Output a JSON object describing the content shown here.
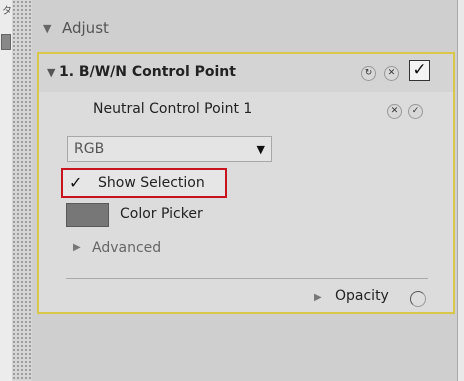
{
  "left_tool": {
    "glyph": "タ"
  },
  "adjust": {
    "label": "Adjust"
  },
  "control_point": {
    "title": "1. B/W/N Control Point",
    "reset_glyph": "↻",
    "delete_glyph": "✕",
    "enabled_glyph": "✓"
  },
  "neutral_point": {
    "label": "Neutral Control Point 1",
    "delete_glyph": "✕",
    "enabled_glyph": "✓"
  },
  "rgb_select": {
    "value": "RGB",
    "arrow": "▼"
  },
  "show_selection": {
    "label": "Show Selection",
    "check": "✓"
  },
  "color_picker": {
    "label": "Color Picker",
    "swatch_color": "#777777"
  },
  "advanced": {
    "label": "Advanced"
  },
  "opacity": {
    "label": "Opacity"
  },
  "colors": {
    "highlight": "#c8141e",
    "panel_border": "#d9c74a"
  }
}
